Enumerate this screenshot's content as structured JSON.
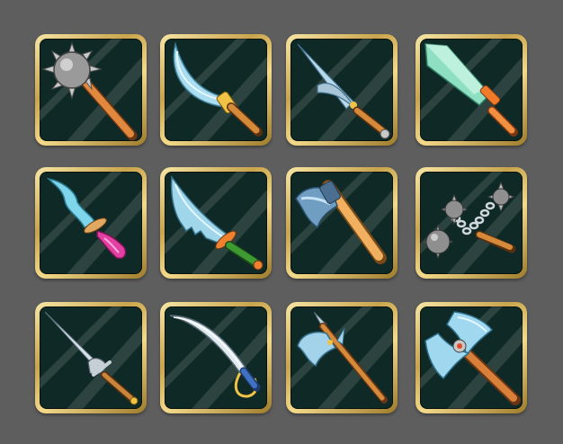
{
  "inventory": {
    "slots": [
      {
        "icon": "mace-icon"
      },
      {
        "icon": "scimitar-icon"
      },
      {
        "icon": "dagger-icon"
      },
      {
        "icon": "crystal-sword-icon"
      },
      {
        "icon": "curved-dagger-icon"
      },
      {
        "icon": "serrated-sword-icon"
      },
      {
        "icon": "axe-icon"
      },
      {
        "icon": "flail-icon"
      },
      {
        "icon": "rapier-icon"
      },
      {
        "icon": "saber-icon"
      },
      {
        "icon": "halberd-icon"
      },
      {
        "icon": "battle-axe-icon"
      }
    ]
  },
  "colors": {
    "background": "#5e5e5e",
    "frame_gold": "#d8b65e",
    "slot_fill": "#0f2a26",
    "blade": "#9fd8ef",
    "handle_wood": "#d9893f"
  }
}
